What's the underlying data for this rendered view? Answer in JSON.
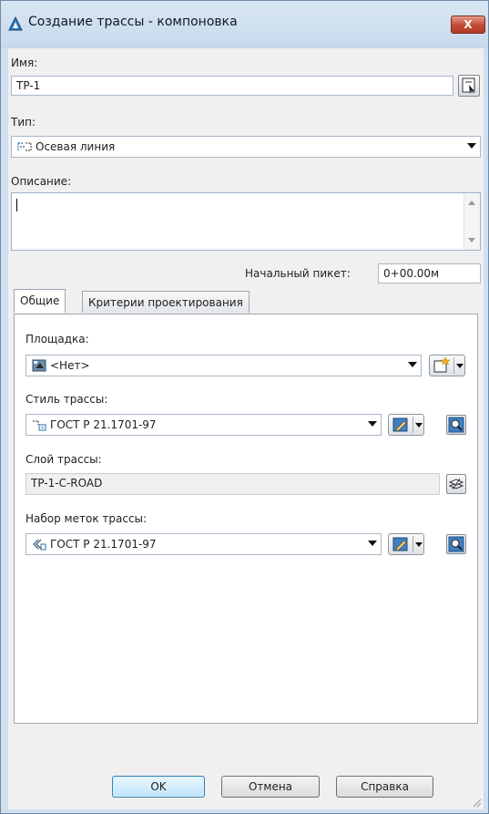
{
  "window": {
    "title": "Создание трассы - компоновка",
    "close_label": "X"
  },
  "name": {
    "label": "Имя:",
    "value": "TP-1"
  },
  "type": {
    "label": "Тип:",
    "value": "Осевая линия"
  },
  "description": {
    "label": "Описание:",
    "value": ""
  },
  "start_station": {
    "label": "Начальный пикет:",
    "value": "0+00.00м"
  },
  "tabs": [
    {
      "label": "Общие",
      "active": true
    },
    {
      "label": "Критерии проектирования",
      "active": false
    }
  ],
  "general": {
    "site": {
      "label": "Площадка:",
      "value": "<Нет>"
    },
    "alignment_style": {
      "label": "Стиль трассы:",
      "value": "ГОСТ Р 21.1701-97"
    },
    "alignment_layer": {
      "label": "Слой трассы:",
      "value": "TP-1-C-ROAD"
    },
    "label_set": {
      "label": "Набор меток трассы:",
      "value": "ГОСТ Р 21.1701-97"
    }
  },
  "buttons": {
    "ok": "OK",
    "cancel": "Отмена",
    "help": "Справка"
  },
  "colors": {
    "close": "#c24a34",
    "default_button": "#bee6fd",
    "frame": "#cfdfee"
  }
}
